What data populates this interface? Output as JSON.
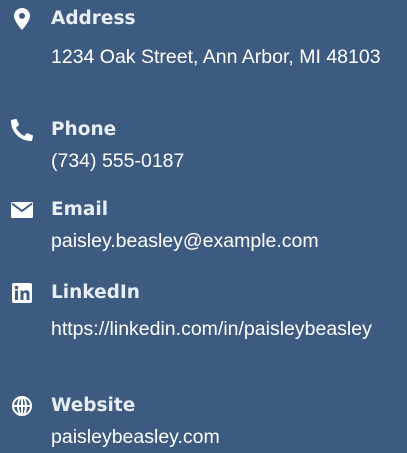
{
  "contact": {
    "address": {
      "icon": "map-marker-icon",
      "label": "Address",
      "value": "1234 Oak Street, Ann Arbor, MI 48103"
    },
    "phone": {
      "icon": "phone-icon",
      "label": "Phone",
      "value": "(734) 555-0187"
    },
    "email": {
      "icon": "envelope-icon",
      "label": "Email",
      "value": "paisley.beasley@example.com"
    },
    "linkedin": {
      "icon": "linkedin-icon",
      "label": "LinkedIn",
      "value": "https://linkedin.com/in/paisleybeasley"
    },
    "website": {
      "icon": "globe-icon",
      "label": "Website",
      "value": "paisleybeasley.com"
    }
  },
  "colors": {
    "background": "#3d5a80",
    "text": "#ffffff",
    "label": "#e8eef5"
  }
}
